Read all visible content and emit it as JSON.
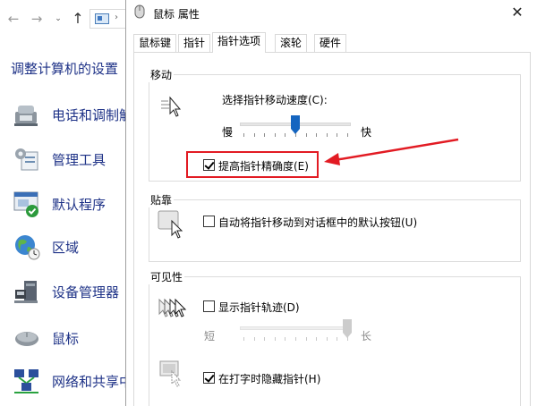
{
  "control_panel": {
    "heading": "调整计算机的设置",
    "items": [
      {
        "label": "电话和调制解",
        "icon": "phone-modem-icon"
      },
      {
        "label": "管理工具",
        "icon": "admin-tools-icon"
      },
      {
        "label": "默认程序",
        "icon": "default-programs-icon"
      },
      {
        "label": "区域",
        "icon": "region-globe-icon"
      },
      {
        "label": "设备管理器",
        "icon": "device-manager-icon"
      },
      {
        "label": "鼠标",
        "icon": "mouse-icon"
      },
      {
        "label": "网络和共享中",
        "icon": "network-icon"
      }
    ]
  },
  "dialog": {
    "title": "鼠标 属性",
    "close_glyph": "✕",
    "tabs": [
      "鼠标键",
      "指针",
      "指针选项",
      "滚轮",
      "硬件"
    ],
    "active_tab": "指针选项",
    "motion": {
      "group_title": "移动",
      "speed_label": "选择指针移动速度(C):",
      "slow": "慢",
      "fast": "快",
      "speed_value_fraction": 0.5,
      "precision_label": "提高指针精确度(E)",
      "precision_checked": true
    },
    "snap_to": {
      "group_title": "贴靠",
      "label": "自动将指针移动到对话框中的默认按钮(U)",
      "checked": false
    },
    "visibility": {
      "group_title": "可见性",
      "trails_label": "显示指针轨迹(D)",
      "trails_checked": false,
      "short": "短",
      "long": "长",
      "trails_value_fraction": 1.0,
      "hide_label": "在打字时隐藏指针(H)",
      "hide_checked": true
    }
  },
  "annotation": {
    "color": "#e21b23"
  }
}
